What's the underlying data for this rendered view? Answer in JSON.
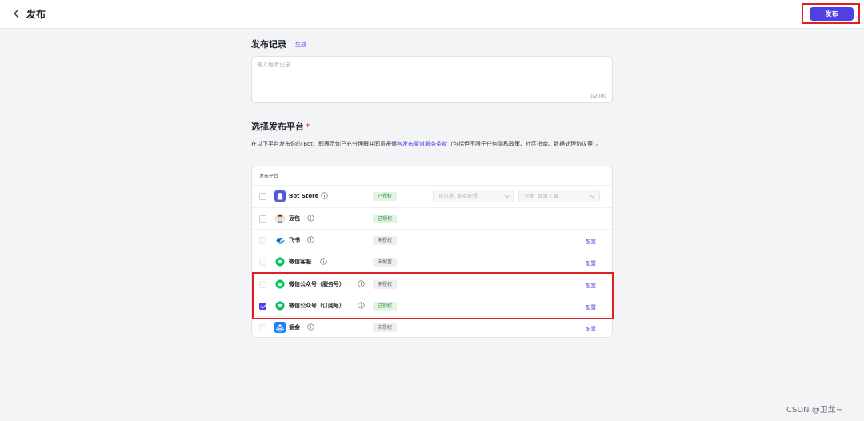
{
  "header": {
    "title": "发布",
    "publish_label": "发布"
  },
  "record": {
    "title": "发布记录",
    "generate_label": "生成",
    "placeholder": "输入版本记录",
    "char_count": "0/2000"
  },
  "platform": {
    "title": "选择发布平台",
    "required_mark": "*",
    "desc_before": "在以下平台发布你的 Bot，即表示你已充分理解并同意遵循",
    "desc_link": "各发布渠道服务条款",
    "desc_after": "（包括但不限于任何隐私政策、社区指南、数据处理协议等）。",
    "table_header": "发布平台",
    "rows": [
      {
        "name": "Bot Store",
        "status": "已授权",
        "config": "",
        "checked": false
      },
      {
        "name": "豆包",
        "status": "已授权",
        "config": "",
        "checked": false
      },
      {
        "name": "飞书",
        "status": "未授权",
        "config": "配置",
        "checked": false
      },
      {
        "name": "微信客服",
        "status": "未配置",
        "config": "配置",
        "checked": false
      },
      {
        "name": "微信公众号（服务号）",
        "status": "未授权",
        "config": "配置",
        "checked": false
      },
      {
        "name": "微信公众号（订阅号）",
        "status": "已授权",
        "config": "配置",
        "checked": true
      },
      {
        "name": "掘金",
        "status": "未授权",
        "config": "配置",
        "checked": false
      }
    ],
    "botstore_selects": {
      "visibility_label": "可见度",
      "visibility_value": "私有配置",
      "category_label": "分类",
      "category_value": "效率工具"
    }
  },
  "watermark": "CSDN @卫龙~",
  "colors": {
    "accent": "#4e40e5",
    "highlight": "#e02020",
    "status_ok": "#2f8f3a"
  }
}
